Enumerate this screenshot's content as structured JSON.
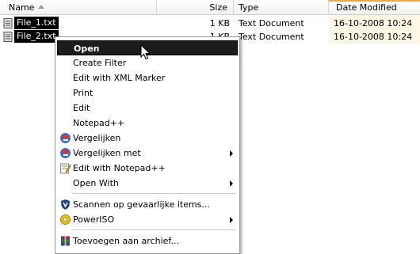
{
  "columns": {
    "name": "Name",
    "size": "Size",
    "type": "Type",
    "date": "Date Modified"
  },
  "files": [
    {
      "name": "File_1.txt",
      "size": "1 KB",
      "type": "Text Document",
      "date": "16-10-2008 10:24"
    },
    {
      "name": "File_2.txt",
      "size": "1 KB",
      "type": "Text Document",
      "date": "16-10-2008 10:24"
    }
  ],
  "menu": {
    "items": [
      {
        "label": "Open",
        "selected": true
      },
      {
        "label": "Create Filter"
      },
      {
        "label": "Edit with XML Marker"
      },
      {
        "label": "Print"
      },
      {
        "label": "Edit"
      },
      {
        "label": "Notepad++"
      },
      {
        "label": "Vergelijken",
        "icon": "compare-icon"
      },
      {
        "label": "Vergelijken met",
        "icon": "compare-icon",
        "submenu": true
      },
      {
        "label": "Edit with Notepad++",
        "icon": "notepad-icon"
      },
      {
        "label": "Open With",
        "submenu": true
      },
      {
        "label": "Scannen op gevaarlijke items...",
        "icon": "shield-icon"
      },
      {
        "label": "PowerISO",
        "icon": "disc-icon",
        "submenu": true
      },
      {
        "label": "Toevoegen aan archief...",
        "icon": "archive-icon"
      }
    ]
  },
  "colors": {
    "selection": "#000000",
    "sort_highlight": "#f0a73a"
  }
}
